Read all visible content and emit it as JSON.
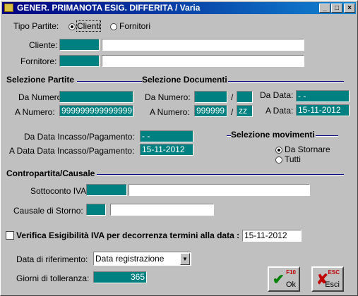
{
  "window": {
    "title": "GENER. PRIMANOTA ESIG. DIFFERITA / Varia"
  },
  "tipo_partite": {
    "label": "Tipo Partite:",
    "options": [
      "Clienti",
      "Fornitori"
    ],
    "selected": "Clienti"
  },
  "cliente": {
    "label": "Cliente:",
    "code": "",
    "description": ""
  },
  "fornitore": {
    "label": "Fornitore:",
    "code": "",
    "description": ""
  },
  "selezione_partite": {
    "title": "Selezione Partite",
    "da_label": "Da Numero:",
    "da_value": "",
    "a_label": "A Numero:",
    "a_value": "999999999999999"
  },
  "selezione_documenti": {
    "title": "Selezione Documenti",
    "da_numero_label": "Da Numero:",
    "da_numero": "",
    "da_serie": "",
    "sep": "/",
    "a_numero_label": "A Numero:",
    "a_numero": "999999",
    "a_serie": "zz",
    "da_data_label": "Da Data:",
    "da_data": "  -  -",
    "a_data_label": "A Data:",
    "a_data": "15-11-2012"
  },
  "incasso": {
    "da_label": "Da Data Incasso/Pagamento:",
    "da_value": "  -  -",
    "a_label": "A Data Data Incasso/Pagamento:",
    "a_value": "15-11-2012"
  },
  "selezione_movimenti": {
    "title": "Selezione movimenti",
    "options": [
      "Da Stornare",
      "Tutti"
    ],
    "selected": "Da Stornare"
  },
  "contropartita": {
    "title": "Contropartita/Causale",
    "sottoconto_label": "Sottoconto IVA:",
    "sottoconto_code": "",
    "sottoconto_desc": "",
    "causale_label": "Causale di Storno:",
    "causale_code": "",
    "causale_desc": ""
  },
  "verifica": {
    "label": "Verifica Esigibilità IVA per decorrenza termini alla data :",
    "checked": false,
    "date": "15-11-2012"
  },
  "data_riferimento": {
    "label": "Data di riferimento:",
    "value": "Data registrazione"
  },
  "tolleranza": {
    "label": "Giorni di tolleranza:",
    "value": "365"
  },
  "buttons": {
    "ok_hint": "F10",
    "ok_label": "Ok",
    "esci_hint": "ESC",
    "esci_label": "Esci"
  },
  "colors": {
    "field_teal": "#008080",
    "title_blue": "#000080",
    "face": "#c0c0c0"
  }
}
